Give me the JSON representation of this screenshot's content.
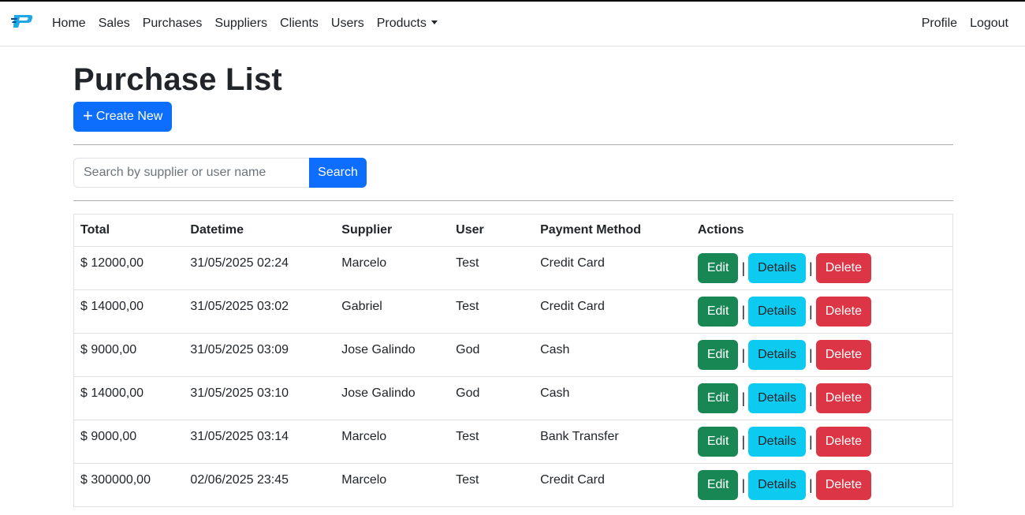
{
  "nav": {
    "brand_icon": "logo-p-icon",
    "items": [
      "Home",
      "Sales",
      "Purchases",
      "Suppliers",
      "Clients",
      "Users"
    ],
    "dropdown_label": "Products",
    "right": [
      "Profile",
      "Logout"
    ]
  },
  "page": {
    "title": "Purchase List",
    "create_label": "Create New",
    "create_icon": "plus-icon"
  },
  "search": {
    "placeholder": "Search by supplier or user name",
    "value": "",
    "button_label": "Search"
  },
  "table": {
    "headers": [
      "Total",
      "Datetime",
      "Supplier",
      "User",
      "Payment Method",
      "Actions"
    ],
    "actions": {
      "edit": "Edit",
      "details": "Details",
      "delete": "Delete",
      "separator": "|"
    },
    "rows": [
      [
        "$ 12000,00",
        "31/05/2025 02:24",
        "Marcelo",
        "Test",
        "Credit Card"
      ],
      [
        "$ 14000,00",
        "31/05/2025 03:02",
        "Gabriel",
        "Test",
        "Credit Card"
      ],
      [
        "$ 9000,00",
        "31/05/2025 03:09",
        "Jose Galindo",
        "God",
        "Cash"
      ],
      [
        "$ 14000,00",
        "31/05/2025 03:10",
        "Jose Galindo",
        "God",
        "Cash"
      ],
      [
        "$ 9000,00",
        "31/05/2025 03:14",
        "Marcelo",
        "Test",
        "Bank Transfer"
      ],
      [
        "$ 300000,00",
        "02/06/2025 23:45",
        "Marcelo",
        "Test",
        "Credit Card"
      ]
    ]
  },
  "colors": {
    "primary": "#0d6efd",
    "success": "#198754",
    "info": "#0dcaf0",
    "danger": "#dc3545"
  }
}
